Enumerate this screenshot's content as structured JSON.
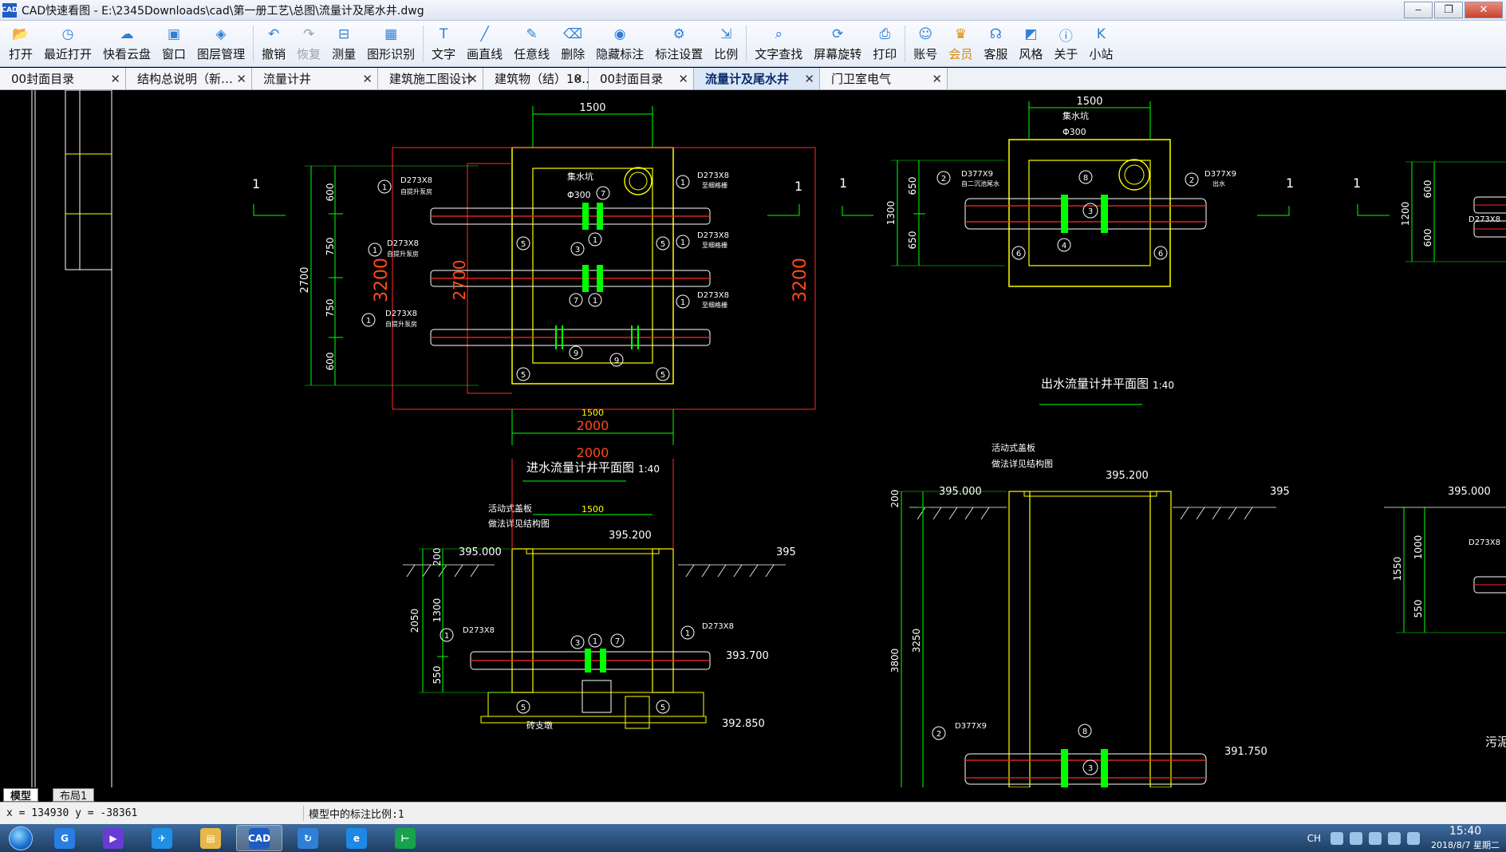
{
  "window": {
    "title": "CAD快速看图 - E:\\2345Downloads\\cad\\第一册工艺\\总图\\流量计及尾水井.dwg",
    "app_icon": "CAD",
    "buttons": [
      "‒",
      "❐",
      "✕"
    ]
  },
  "toolbar": [
    {
      "label": "打开",
      "icon": "folder-open-icon"
    },
    {
      "label": "最近打开",
      "icon": "clock-icon"
    },
    {
      "label": "快看云盘",
      "icon": "cloud-icon"
    },
    {
      "label": "窗口",
      "icon": "window-icon"
    },
    {
      "label": "图层管理",
      "icon": "layers-icon"
    },
    {
      "label": "撤销",
      "icon": "undo-icon"
    },
    {
      "label": "恢复",
      "icon": "redo-icon",
      "disabled": true
    },
    {
      "label": "测量",
      "icon": "ruler-icon"
    },
    {
      "label": "图形识别",
      "icon": "shape-recognize-icon"
    },
    {
      "label": "文字",
      "icon": "text-icon"
    },
    {
      "label": "画直线",
      "icon": "line-icon"
    },
    {
      "label": "任意线",
      "icon": "pen-icon"
    },
    {
      "label": "删除",
      "icon": "eraser-icon"
    },
    {
      "label": "隐藏标注",
      "icon": "eye-icon"
    },
    {
      "label": "标注设置",
      "icon": "settings-icon"
    },
    {
      "label": "比例",
      "icon": "scale-icon"
    },
    {
      "label": "文字查找",
      "icon": "find-text-icon"
    },
    {
      "label": "屏幕旋转",
      "icon": "rotate-icon"
    },
    {
      "label": "打印",
      "icon": "printer-icon"
    },
    {
      "label": "账号",
      "icon": "user-icon"
    },
    {
      "label": "会员",
      "icon": "vip-icon",
      "vip": true
    },
    {
      "label": "客服",
      "icon": "headset-icon"
    },
    {
      "label": "风格",
      "icon": "style-icon"
    },
    {
      "label": "关于",
      "icon": "info-icon"
    },
    {
      "label": "小站",
      "icon": "k-logo-icon"
    }
  ],
  "tabs": [
    {
      "label": "00封面目录",
      "close": "✕"
    },
    {
      "label": "结构总说明（新…",
      "close": "✕"
    },
    {
      "label": "流量计井",
      "close": "✕"
    },
    {
      "label": "建筑施工图设计",
      "close": "✕"
    },
    {
      "label": "建筑物（结）10…",
      "close": "✕"
    },
    {
      "label": "00封面目录",
      "close": "✕"
    },
    {
      "label": "流量计及尾水井",
      "close": "✕",
      "active": true
    },
    {
      "label": "门卫室电气",
      "close": "✕"
    }
  ],
  "drawing": {
    "colors": {
      "green": "#00ff00",
      "yellow": "#ffff00",
      "red": "#ff2a2a",
      "orange": "#ff4a1a",
      "white": "#ffffff",
      "cyan": "#00ffff"
    },
    "dim_1500_a": "1500",
    "dim_1500_b": "1500",
    "dim_1500_c": "1500",
    "dim_2000_a": "2000",
    "dim_2000_b": "2000",
    "dim_3200_a": "3200",
    "dim_3200_b": "3200",
    "dim_2700_a": "2700",
    "dim_2700_b": "2700",
    "dim_600_a": "600",
    "dim_750_a": "750",
    "dim_750_b": "750",
    "dim_600_b": "600",
    "sec_1": "1",
    "d273": "D273X8",
    "d377": "D377X9",
    "pipe_note_in": "自提升泵房",
    "pipe_note_out": "至细格栅",
    "collect_pit": "集水坑",
    "phi300": "Φ300",
    "title_in": "进水流量计井平面图",
    "title_out": "出水流量计井平面图",
    "scale_140": "1:40",
    "cover_note1": "活动式盖板",
    "cover_note2": "做法详见结构图",
    "lvl_395000": "395.000",
    "lvl_395200": "395.200",
    "lvl_395": "395",
    "lvl_393700": "393.700",
    "lvl_392850": "392.850",
    "lvl_391750": "391.750",
    "dim_200": "200",
    "dim_2050": "2050",
    "dim_1300": "1300",
    "dim_550": "550",
    "dim_1300_b": "1300",
    "dim_650_a": "650",
    "dim_650_b": "650",
    "dim_1200": "1200",
    "dim_600_c": "600",
    "dim_600_d": "600",
    "dim_3800": "3800",
    "dim_3250": "3250",
    "dim_1550": "1550",
    "dim_1000": "1000",
    "dim_550_b": "550",
    "brick_pier": "砖支墩",
    "n1": "1",
    "n2": "2",
    "n3": "3",
    "n4": "4",
    "n5": "5",
    "n6": "6",
    "n7": "7",
    "n8": "8",
    "n9": "9",
    "note_out": "出水",
    "note_sludge": "污泥",
    "note_lift": "自提升泵房",
    "note_settle": "自二沉池尾水"
  },
  "layout_tabs": [
    "模型",
    "布局1"
  ],
  "status": {
    "coords": "x = 134930  y = -38361",
    "scale_text": "模型中的标注比例:1"
  },
  "taskbar": {
    "apps": [
      {
        "name": "browser-2345",
        "color": "#2a7de1",
        "text": "G"
      },
      {
        "name": "video-app",
        "color": "#6a3ad6",
        "text": "▶"
      },
      {
        "name": "feige-app",
        "color": "#1f8fe6",
        "text": "✈"
      },
      {
        "name": "explorer",
        "color": "#e8b74a",
        "text": "▤"
      },
      {
        "name": "cad-app",
        "color": "#1c5cc4",
        "text": "CAD",
        "active": true
      },
      {
        "name": "tool-app",
        "color": "#2f7fd6",
        "text": "↻"
      },
      {
        "name": "ie",
        "color": "#1e88e5",
        "text": "e"
      },
      {
        "name": "project-app",
        "color": "#16a34a",
        "text": "⊢"
      }
    ],
    "lang": "CH",
    "time": "15:40",
    "date": "2018/8/7 星期二"
  }
}
